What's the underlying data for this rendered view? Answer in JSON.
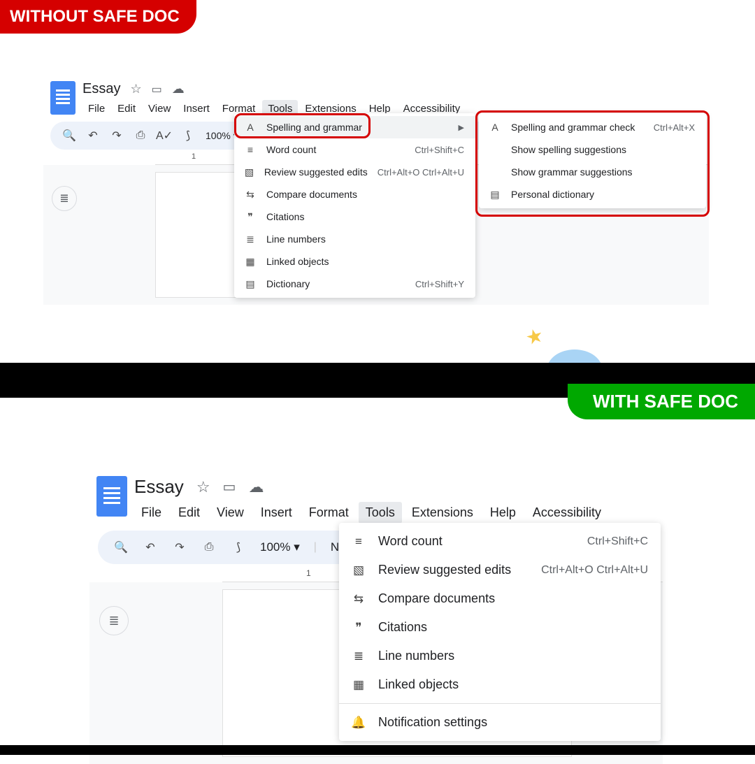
{
  "badges": {
    "without": "WITHOUT SAFE DOC",
    "with": "WITH SAFE DOC"
  },
  "panel1": {
    "title": "Essay",
    "menus": [
      "File",
      "Edit",
      "View",
      "Insert",
      "Format",
      "Tools",
      "Extensions",
      "Help",
      "Accessibility"
    ],
    "zoom": "100%",
    "ruler_num": "1",
    "tools_menu": [
      {
        "icon": "spellcheck",
        "label": "Spelling and grammar",
        "shortcut": "",
        "arrow": true,
        "hl": true
      },
      {
        "icon": "wordcount",
        "label": "Word count",
        "shortcut": "Ctrl+Shift+C"
      },
      {
        "icon": "review",
        "label": "Review suggested edits",
        "shortcut": "Ctrl+Alt+O Ctrl+Alt+U"
      },
      {
        "icon": "compare",
        "label": "Compare documents",
        "shortcut": ""
      },
      {
        "icon": "quote",
        "label": "Citations",
        "shortcut": ""
      },
      {
        "icon": "lines",
        "label": "Line numbers",
        "shortcut": ""
      },
      {
        "icon": "linked",
        "label": "Linked objects",
        "shortcut": ""
      },
      {
        "icon": "dict",
        "label": "Dictionary",
        "shortcut": "Ctrl+Shift+Y"
      }
    ],
    "submenu": [
      {
        "icon": "spellcheck",
        "label": "Spelling and grammar check",
        "shortcut": "Ctrl+Alt+X"
      },
      {
        "icon": "",
        "label": "Show spelling suggestions",
        "shortcut": ""
      },
      {
        "icon": "",
        "label": "Show grammar suggestions",
        "shortcut": ""
      },
      {
        "icon": "dict",
        "label": "Personal dictionary",
        "shortcut": ""
      }
    ]
  },
  "panel2": {
    "title": "Essay",
    "menus": [
      "File",
      "Edit",
      "View",
      "Insert",
      "Format",
      "Tools",
      "Extensions",
      "Help",
      "Accessibility"
    ],
    "zoom": "100%",
    "ruler_num": "1",
    "truncated_text": "No",
    "tools_menu": [
      {
        "icon": "wordcount",
        "label": "Word count",
        "shortcut": "Ctrl+Shift+C"
      },
      {
        "icon": "review",
        "label": "Review suggested edits",
        "shortcut": "Ctrl+Alt+O Ctrl+Alt+U"
      },
      {
        "icon": "compare",
        "label": "Compare documents",
        "shortcut": ""
      },
      {
        "icon": "quote",
        "label": "Citations",
        "shortcut": ""
      },
      {
        "icon": "lines",
        "label": "Line numbers",
        "shortcut": ""
      },
      {
        "icon": "linked",
        "label": "Linked objects",
        "shortcut": ""
      },
      {
        "sep": true
      },
      {
        "icon": "bell",
        "label": "Notification settings",
        "shortcut": ""
      }
    ]
  },
  "icons": {
    "spellcheck": "A✓",
    "wordcount": "≡",
    "review": "⧉",
    "compare": "⇄",
    "quote": "❞",
    "lines": "≣",
    "linked": "▦",
    "dict": "▤",
    "bell": "🔔",
    "star": "☆",
    "folder": "▭",
    "cloud": "☁",
    "search": "🔍",
    "undo": "↶",
    "redo": "↷",
    "print": "⎙",
    "paint": "⟆",
    "zoomdd": "▾"
  }
}
